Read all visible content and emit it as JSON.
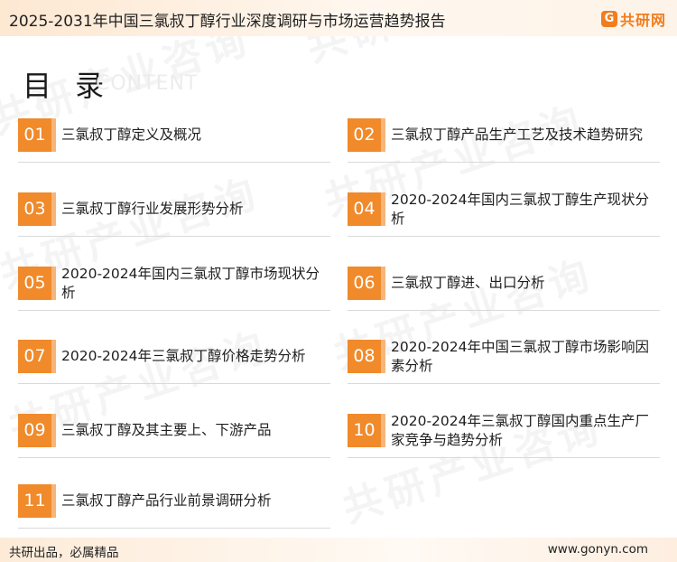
{
  "header": {
    "title": "2025-2031年中国三氯叔丁醇行业深度调研与市场运营趋势报告",
    "logo_text": "共研网"
  },
  "watermark_text": "共研产业咨询",
  "toc": {
    "heading": "目 录",
    "subheading": "CONTENT",
    "items": [
      {
        "num": "01",
        "label": "三氯叔丁醇定义及概况"
      },
      {
        "num": "02",
        "label": "三氯叔丁醇产品生产工艺及技术趋势研究"
      },
      {
        "num": "03",
        "label": "三氯叔丁醇行业发展形势分析"
      },
      {
        "num": "04",
        "label": "2020-2024年国内三氯叔丁醇生产现状分析"
      },
      {
        "num": "05",
        "label": "2020-2024年国内三氯叔丁醇市场现状分析"
      },
      {
        "num": "06",
        "label": "三氯叔丁醇进、出口分析"
      },
      {
        "num": "07",
        "label": "2020-2024年三氯叔丁醇价格走势分析"
      },
      {
        "num": "08",
        "label": "2020-2024年中国三氯叔丁醇市场影响因素分析"
      },
      {
        "num": "09",
        "label": "三氯叔丁醇及其主要上、下游产品"
      },
      {
        "num": "10",
        "label": "2020-2024年三氯叔丁醇国内重点生产厂家竞争与趋势分析"
      },
      {
        "num": "11",
        "label": "三氯叔丁醇产品行业前景调研分析"
      }
    ]
  },
  "footer": {
    "slogan": "共研出品，必属精品",
    "website": "www.gonyn.com"
  },
  "colors": {
    "accent": "#f08a2a",
    "accent_light": "#f6b57a"
  }
}
